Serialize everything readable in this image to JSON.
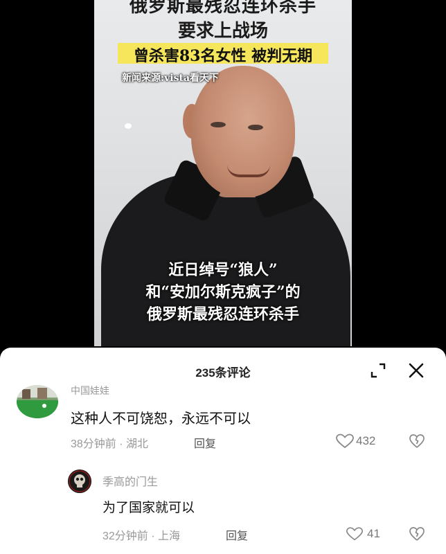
{
  "video": {
    "headline_line1": "俄罗斯最残忍连环杀手",
    "headline_line2": "要求上战场",
    "highlight": "曾杀害83名女性 被判无期",
    "source": "新闻来源:vista看天下",
    "caption_line1": "近日绰号“狼人”",
    "caption_line2": "和“安加尔斯克疯子”的",
    "caption_line3": "俄罗斯最残忍连环杀手",
    "highlight_color": "#f6e65c"
  },
  "comments_panel": {
    "title": "235条评论",
    "icons": [
      "collapse-icon",
      "close-icon"
    ]
  },
  "comments": [
    {
      "username": "中国娃娃",
      "text": "这种人不可饶恕，永远不可以",
      "meta": "38分钟前 · 湖北",
      "reply_label": "回复",
      "likes": "432"
    },
    {
      "username": "季高的门生",
      "text": "为了国家就可以",
      "meta": "32分钟前 · 上海",
      "reply_label": "回复",
      "likes": "41"
    }
  ]
}
